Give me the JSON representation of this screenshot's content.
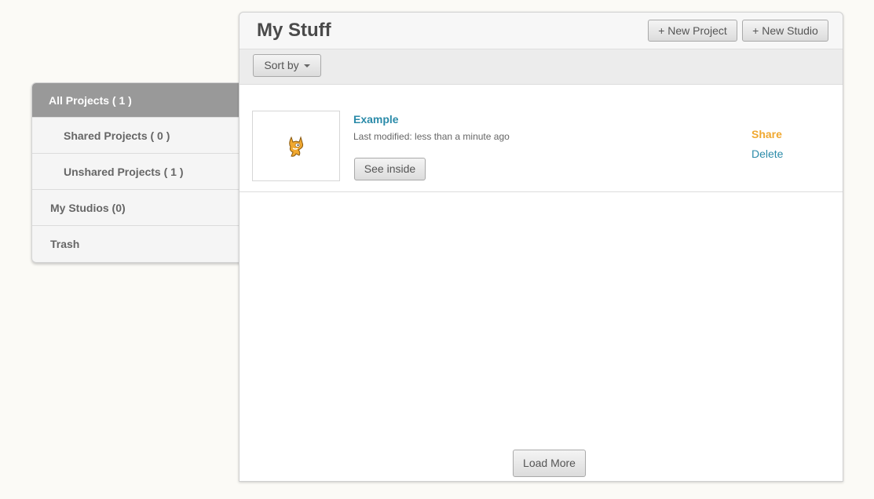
{
  "sidebar": {
    "items": [
      {
        "label": "All Projects ( 1 )"
      },
      {
        "label": "Shared Projects ( 0 )"
      },
      {
        "label": "Unshared Projects ( 1 )"
      },
      {
        "label": "My Studios (0)"
      },
      {
        "label": "Trash"
      }
    ]
  },
  "header": {
    "title": "My Stuff",
    "new_project_label": "+ New Project",
    "new_studio_label": "+ New Studio"
  },
  "toolbar": {
    "sort_label": "Sort by"
  },
  "projects": [
    {
      "title": "Example",
      "meta": "Last modified: less than a minute ago",
      "see_inside_label": "See inside",
      "share_label": "Share",
      "delete_label": "Delete",
      "thumbnail_icon": "scratch-cat-icon"
    }
  ],
  "footer": {
    "load_more_label": "Load More"
  },
  "colors": {
    "link": "#2b8ba9",
    "share": "#f0a830",
    "active_sidebar": "#999999"
  }
}
